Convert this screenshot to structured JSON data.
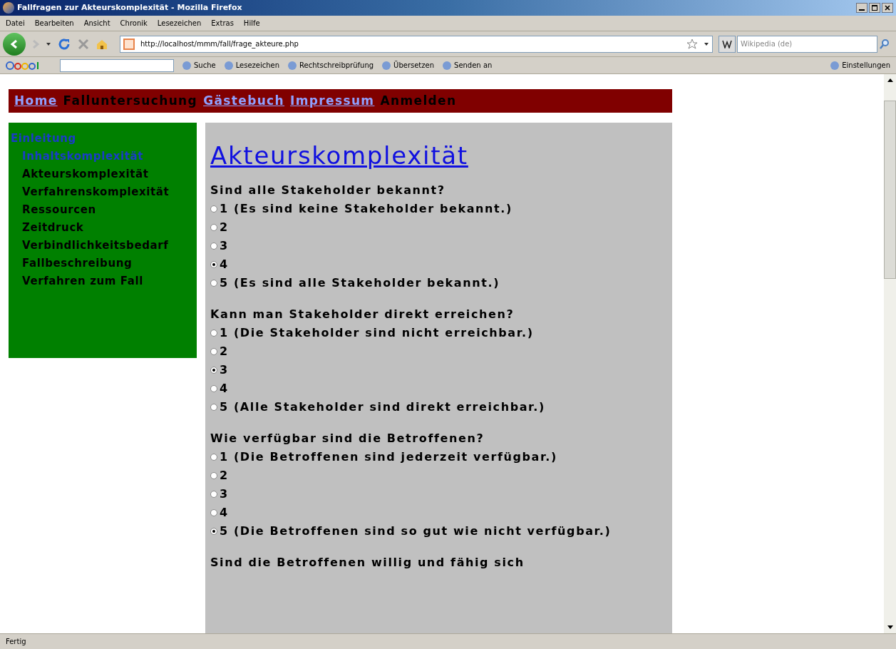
{
  "window": {
    "title": "Fallfragen zur Akteurskomplexität - Mozilla Firefox"
  },
  "menu": [
    "Datei",
    "Bearbeiten",
    "Ansicht",
    "Chronik",
    "Lesezeichen",
    "Extras",
    "Hilfe"
  ],
  "address": "http://localhost/mmm/fall/frage_akteure.php",
  "search": {
    "placeholder": "Wikipedia (de)"
  },
  "google_toolbar": [
    "Suche",
    "Lesezeichen",
    "Rechtschreibprüfung",
    "Übersetzen",
    "Senden an",
    "Einstellungen"
  ],
  "nav": [
    {
      "label": "Home",
      "kind": "link"
    },
    {
      "label": "Falluntersuchung",
      "kind": "text"
    },
    {
      "label": "Gästebuch",
      "kind": "link"
    },
    {
      "label": "Impressum",
      "kind": "link"
    },
    {
      "label": "Anmelden",
      "kind": "text"
    }
  ],
  "sidebar": [
    {
      "label": "Einleitung",
      "kind": "link",
      "children": [
        {
          "label": "Inhaltskomplexität",
          "kind": "link"
        },
        {
          "label": "Akteurskomplexität",
          "kind": "text"
        },
        {
          "label": "Verfahrenskomplexität",
          "kind": "text"
        },
        {
          "label": "Ressourcen",
          "kind": "text"
        },
        {
          "label": "Zeitdruck",
          "kind": "text"
        },
        {
          "label": "Verbindlichkeitsbedarf",
          "kind": "text"
        },
        {
          "label": "Fallbeschreibung",
          "kind": "text"
        },
        {
          "label": "Verfahren zum Fall",
          "kind": "text"
        }
      ]
    }
  ],
  "heading": "Akteurskomplexität",
  "questions": [
    {
      "text": "Sind alle Stakeholder bekannt?",
      "options": [
        {
          "label": "1 (Es sind keine Stakeholder bekannt.)",
          "selected": false
        },
        {
          "label": "2",
          "selected": false
        },
        {
          "label": "3",
          "selected": false
        },
        {
          "label": "4",
          "selected": true
        },
        {
          "label": "5 (Es sind alle Stakeholder bekannt.)",
          "selected": false
        }
      ]
    },
    {
      "text": "Kann man Stakeholder direkt erreichen?",
      "options": [
        {
          "label": "1 (Die Stakeholder sind nicht erreichbar.)",
          "selected": false
        },
        {
          "label": "2",
          "selected": false
        },
        {
          "label": "3",
          "selected": true
        },
        {
          "label": "4",
          "selected": false
        },
        {
          "label": "5 (Alle Stakeholder sind direkt erreichbar.)",
          "selected": false
        }
      ]
    },
    {
      "text": "Wie verfügbar sind die Betroffenen?",
      "options": [
        {
          "label": "1 (Die Betroffenen sind jederzeit verfügbar.)",
          "selected": false
        },
        {
          "label": "2",
          "selected": false
        },
        {
          "label": "3",
          "selected": false
        },
        {
          "label": "4",
          "selected": false
        },
        {
          "label": "5 (Die Betroffenen sind so gut wie nicht verfügbar.)",
          "selected": true
        }
      ]
    },
    {
      "text": "Sind die Betroffenen willig und fähig sich"
    }
  ],
  "status_bar": "Fertig"
}
